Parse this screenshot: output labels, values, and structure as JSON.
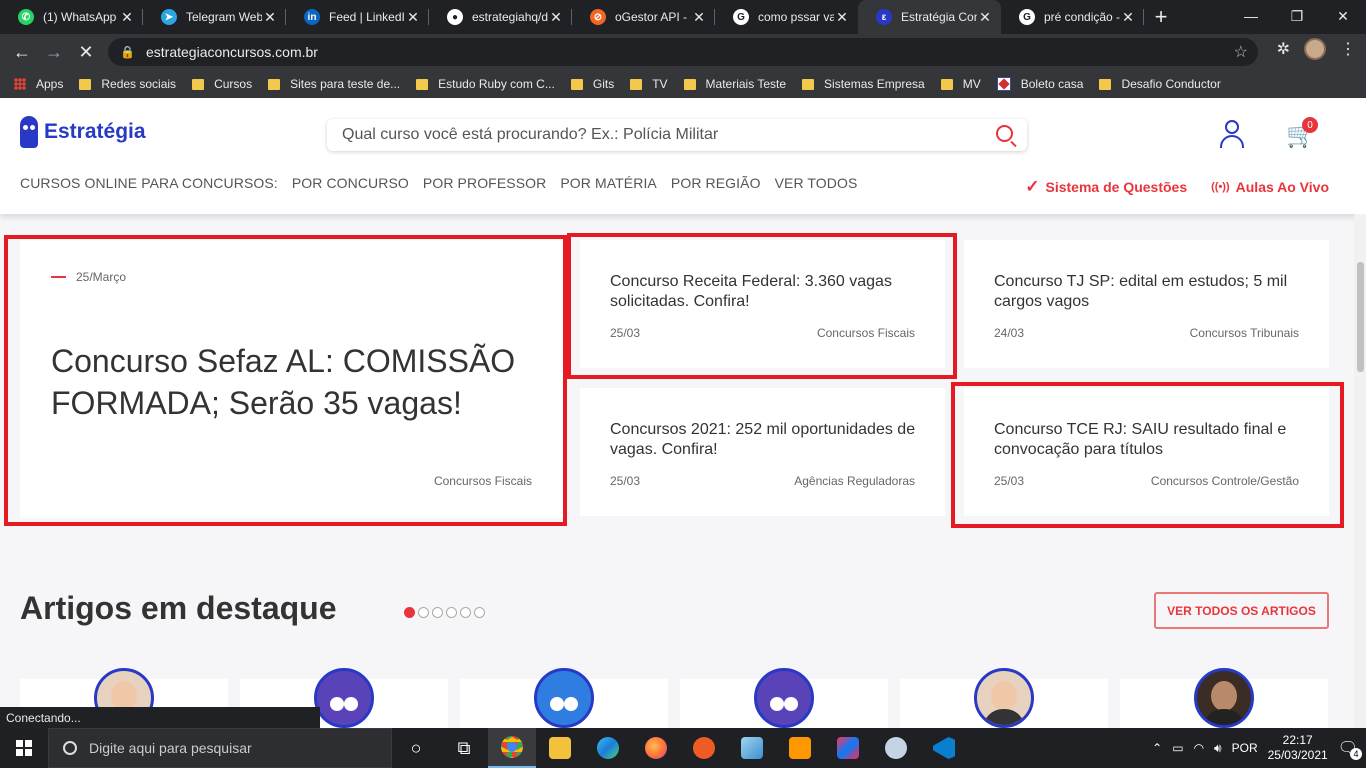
{
  "browser": {
    "tabs": [
      {
        "title": "(1) WhatsApp",
        "fav_color": "#25d366",
        "fav_glyph": "✆"
      },
      {
        "title": "Telegram Web",
        "fav_color": "#2ca5e0",
        "fav_glyph": "➤"
      },
      {
        "title": "Feed | LinkedIn",
        "fav_color": "#0a66c2",
        "fav_glyph": "in"
      },
      {
        "title": "estrategiahq/d",
        "fav_color": "#ffffff",
        "fav_glyph": "●"
      },
      {
        "title": "oGestor API - c",
        "fav_color": "#f26522",
        "fav_glyph": "⊘"
      },
      {
        "title": "como pssar va",
        "fav_color": "#ffffff",
        "fav_glyph": "G"
      },
      {
        "title": "Estratégia Con",
        "fav_color": "#2739c5",
        "fav_glyph": "ε"
      },
      {
        "title": "pré condição -",
        "fav_color": "#ffffff",
        "fav_glyph": "G"
      }
    ],
    "new_tab": "+",
    "url": "estrategiaconcursos.com.br",
    "bookmarks": [
      {
        "label": "Apps",
        "kind": "apps"
      },
      {
        "label": "Redes  sociais",
        "kind": "folder"
      },
      {
        "label": "Cursos",
        "kind": "folder"
      },
      {
        "label": "Sites para teste de...",
        "kind": "folder"
      },
      {
        "label": "Estudo Ruby com C...",
        "kind": "folder"
      },
      {
        "label": "Gits",
        "kind": "folder"
      },
      {
        "label": "TV",
        "kind": "folder"
      },
      {
        "label": "Materiais Teste",
        "kind": "folder"
      },
      {
        "label": "Sistemas Empresa",
        "kind": "folder"
      },
      {
        "label": "MV",
        "kind": "folder"
      },
      {
        "label": "Boleto casa",
        "kind": "boleto"
      },
      {
        "label": "Desafio Conductor",
        "kind": "folder"
      }
    ],
    "status_text": "Conectando..."
  },
  "site": {
    "logo": "Estratégia",
    "search_placeholder": "Qual curso você está procurando? Ex.: Polícia Militar",
    "cart_count": "0",
    "nav": [
      "CURSOS ONLINE PARA CONCURSOS:",
      "POR CONCURSO",
      "POR PROFESSOR",
      "POR MATÉRIA",
      "POR REGIÃO",
      "VER TODOS"
    ],
    "nav_right": [
      {
        "label": "Sistema de Questões",
        "icon": "✓"
      },
      {
        "label": "Aulas Ao Vivo",
        "icon": "((•))"
      }
    ]
  },
  "news": {
    "featured": {
      "date": "25/Março",
      "title": "Concurso Sefaz AL: COMISSÃO FORMADA; Serão 35 vagas!",
      "category": "Concursos Fiscais"
    },
    "items": [
      {
        "title": "Concurso Receita Federal: 3.360 vagas solicitadas. Confira!",
        "date": "25/03",
        "category": "Concursos Fiscais"
      },
      {
        "title": "Concurso TJ SP: edital em estudos; 5 mil cargos vagos",
        "date": "24/03",
        "category": "Concursos Tribunais"
      },
      {
        "title": "Concursos 2021: 252 mil oportunidades de vagas. Confira!",
        "date": "25/03",
        "category": "Agências Reguladoras"
      },
      {
        "title": "Concurso TCE RJ: SAIU resultado final e convocação para títulos",
        "date": "25/03",
        "category": "Concursos Controle/Gestão"
      }
    ]
  },
  "featured_articles": {
    "heading": "Artigos em destaque",
    "view_all": "VER TODOS OS ARTIGOS",
    "dots": 6,
    "active_dot": 0
  },
  "taskbar": {
    "search_placeholder": "Digite aqui para pesquisar",
    "language": "POR",
    "time": "22:17",
    "date": "25/03/2021",
    "notifications": "4"
  }
}
